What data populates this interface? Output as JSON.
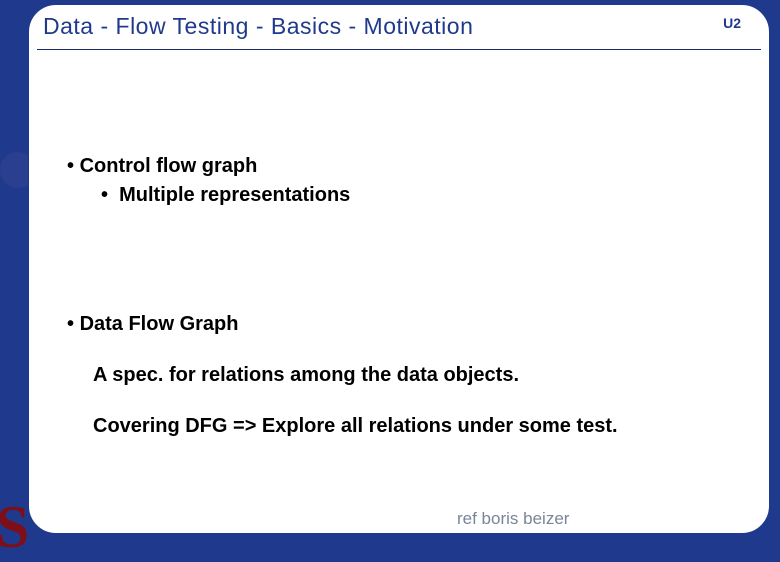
{
  "header": {
    "title": "Data - Flow Testing   -  Basics  - Motivation",
    "badge": "U2"
  },
  "bullets": {
    "cfg": "Control flow graph",
    "cfg_sub": "Multiple representations",
    "dfg": "Data Flow Graph",
    "spec": "A spec. for relations among the data objects.",
    "cover": "Covering DFG  => Explore all relations under some test."
  },
  "footer": {
    "ref": "ref boris beizer"
  },
  "decor": {
    "letter": "S"
  }
}
